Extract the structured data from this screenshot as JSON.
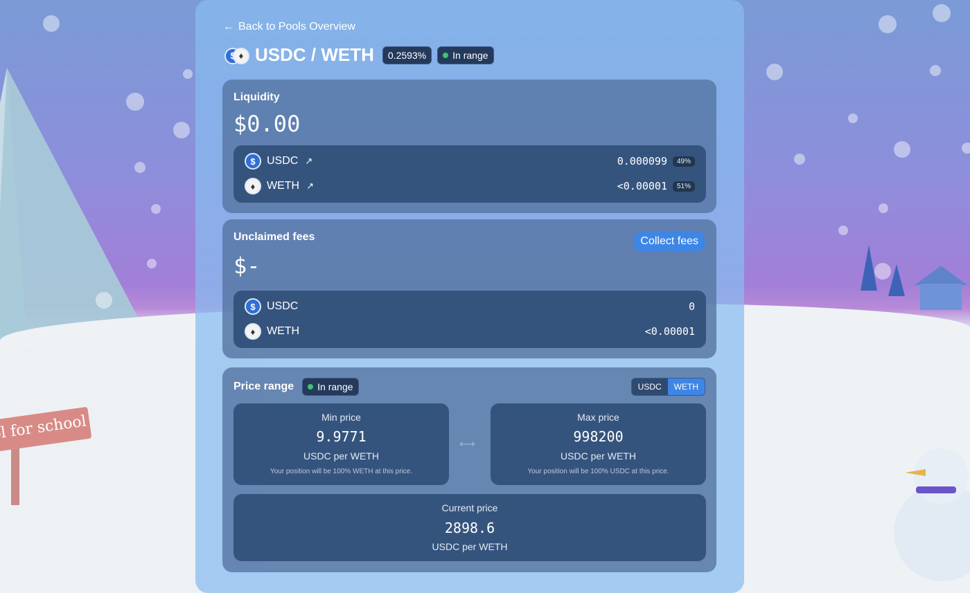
{
  "back_link": "Back to Pools Overview",
  "pool": {
    "token0": "USDC",
    "token1": "WETH",
    "title": "USDC / WETH",
    "fee_badge": "0.2593%",
    "status_badge": "In range"
  },
  "liquidity": {
    "label": "Liquidity",
    "value": "$0.00",
    "rows": [
      {
        "symbol": "USDC",
        "amount": "0.000099",
        "percent": "49%"
      },
      {
        "symbol": "WETH",
        "amount": "<0.00001",
        "percent": "51%"
      }
    ]
  },
  "fees": {
    "label": "Unclaimed fees",
    "value": "$-",
    "collect_button": "Collect fees",
    "rows": [
      {
        "symbol": "USDC",
        "amount": "0"
      },
      {
        "symbol": "WETH",
        "amount": "<0.00001"
      }
    ]
  },
  "price_range": {
    "label": "Price range",
    "status_badge": "In range",
    "toggle": {
      "left": "USDC",
      "right": "WETH",
      "active": "WETH"
    },
    "min": {
      "label": "Min price",
      "value": "9.9771",
      "unit": "USDC per WETH",
      "note": "Your position will be 100% WETH at this price."
    },
    "max": {
      "label": "Max price",
      "value": "998200",
      "unit": "USDC per WETH",
      "note": "Your position will be 100% USDC at this price."
    },
    "current": {
      "label": "Current price",
      "value": "2898.6",
      "unit": "USDC per WETH"
    }
  },
  "background": {
    "sign_text": "ol for school"
  },
  "colors": {
    "accent": "#3e86e6",
    "in_range": "#3ec46d",
    "card": "#35547d"
  }
}
